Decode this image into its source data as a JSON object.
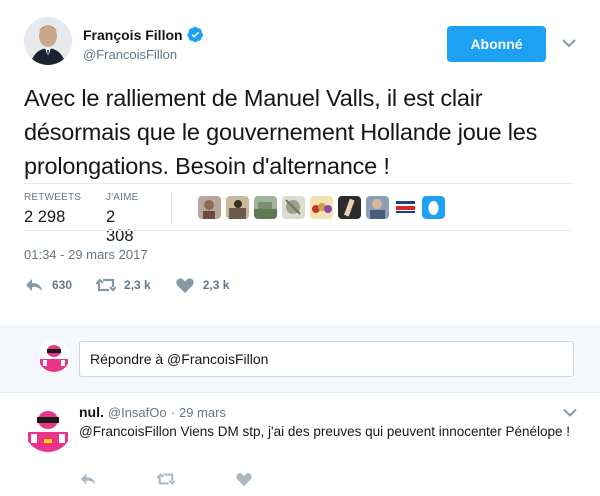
{
  "author": {
    "name": "François Fillon",
    "handle": "@FrancoisFillon",
    "verified": true
  },
  "follow_button": {
    "label": "Abonné"
  },
  "tweet": {
    "text": "Avec le ralliement de Manuel Valls, il est clair désormais que le gouvernement Hollande joue les prolongations. Besoin d'alternance !",
    "timestamp": "01:34 - 29 mars 2017"
  },
  "stats": {
    "retweets_label": "RETWEETS",
    "retweets_value": "2 298",
    "likes_label": "J'AIME",
    "likes_value": "2 308"
  },
  "liker_avatars": [
    {
      "name": "liker-1",
      "color": "#8a6b5a"
    },
    {
      "name": "liker-2",
      "color": "#6b5a47"
    },
    {
      "name": "liker-3",
      "color": "#5f7a52"
    },
    {
      "name": "liker-4",
      "color": "#9aa08a"
    },
    {
      "name": "liker-5",
      "color": "#c9a23c"
    },
    {
      "name": "liker-6",
      "color": "#2b2b2b"
    },
    {
      "name": "liker-7",
      "color": "#4a5a7a"
    },
    {
      "name": "liker-8",
      "color": "#ffffff"
    },
    {
      "name": "liker-9",
      "color": "#1da1f2"
    }
  ],
  "actions": {
    "reply_count": "630",
    "retweet_count": "2,3 k",
    "like_count": "2,3 k"
  },
  "reply_box": {
    "placeholder": "Répondre à @FrancoisFillon"
  },
  "reply": {
    "name": "nul.",
    "handle": "@InsafOo",
    "separator": "·",
    "time": "29 mars",
    "text": "@FrancoisFillon Viens DM stp, j'ai des preuves qui peuvent innocenter Pénélope !"
  },
  "colors": {
    "accent": "#1da1f2",
    "muted": "#657786",
    "text": "#14171a",
    "divider": "#e6ecf0",
    "reply_bg": "#f5f8fa"
  }
}
